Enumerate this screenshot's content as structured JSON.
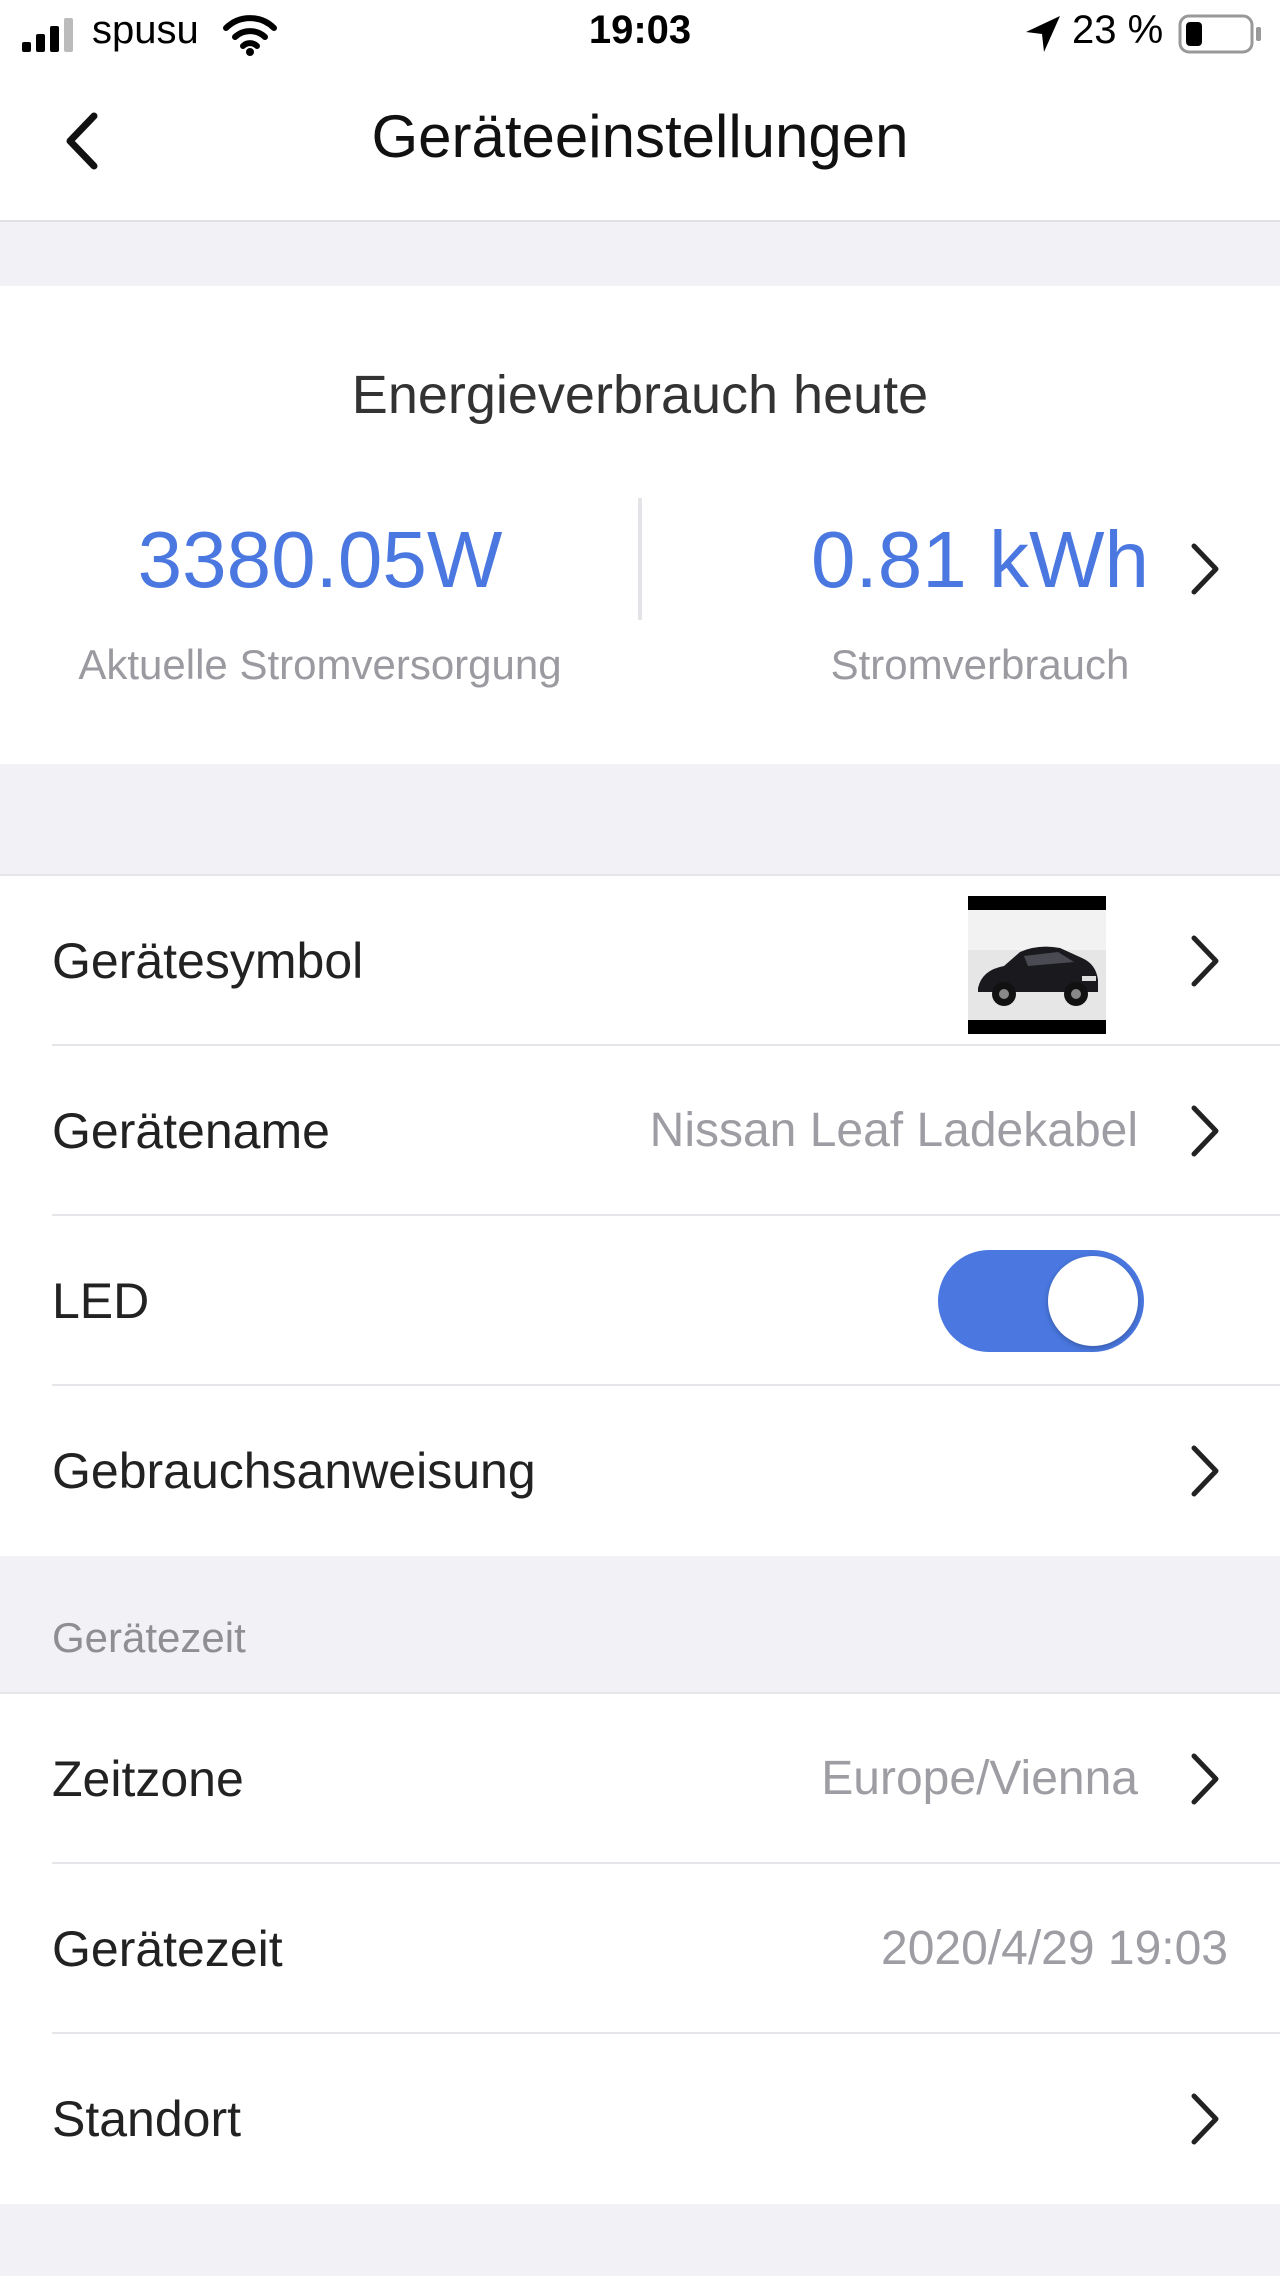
{
  "status_bar": {
    "carrier": "spusu",
    "time": "19:03",
    "battery": "23 %"
  },
  "nav": {
    "title": "Geräteeinstellungen"
  },
  "energy": {
    "title": "Energieverbrauch heute",
    "current_power_value": "3380.05W",
    "current_power_label": "Aktuelle Stromversorgung",
    "consumption_value": "0.81 kWh",
    "consumption_label": "Stromverbrauch"
  },
  "settings": {
    "device_icon_label": "Gerätesymbol",
    "device_name_label": "Gerätename",
    "device_name_value": "Nissan Leaf Ladekabel",
    "led_label": "LED",
    "led_enabled": true,
    "manual_label": "Gebrauchsanweisung"
  },
  "device_time_section": {
    "header": "Gerätezeit",
    "timezone_label": "Zeitzone",
    "timezone_value": "Europe/Vienna",
    "device_time_label": "Gerätezeit",
    "device_time_value": "2020/4/29 19:03",
    "location_label": "Standort"
  },
  "colors": {
    "accent": "#4a78e0",
    "background": "#f1f1f6",
    "secondary_text": "#9d9da3"
  },
  "icons": [
    "signal-icon",
    "wifi-icon",
    "location-arrow-icon",
    "battery-icon",
    "back-chevron-icon",
    "chevron-right-icon"
  ]
}
